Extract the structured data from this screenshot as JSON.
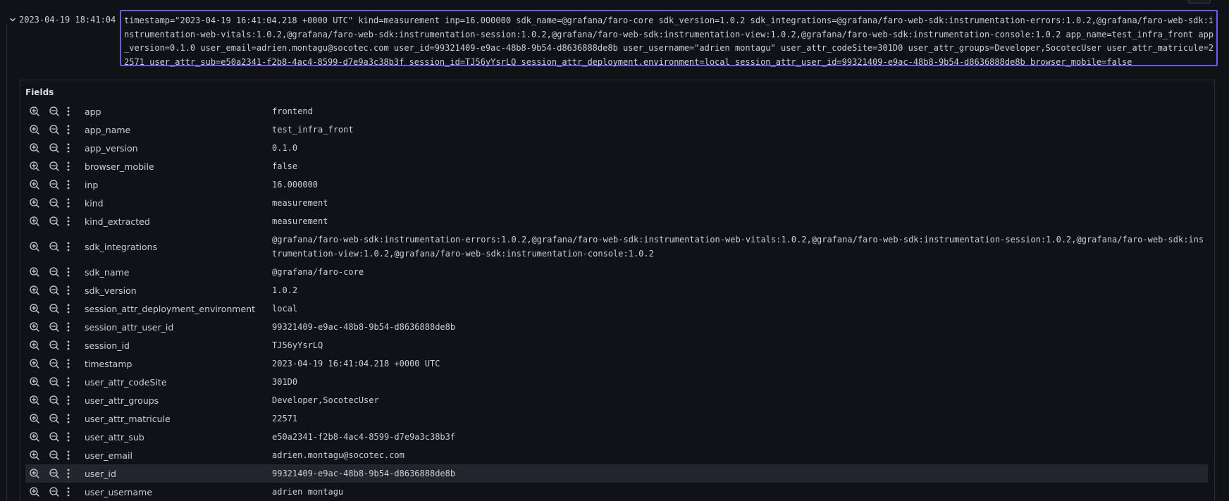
{
  "log": {
    "timestamp": "2023-04-19 18:41:04",
    "line": "timestamp=\"2023-04-19 16:41:04.218 +0000 UTC\" kind=measurement inp=16.000000 sdk_name=@grafana/faro-core sdk_version=1.0.2 sdk_integrations=@grafana/faro-web-sdk:instrumentation-errors:1.0.2,@grafana/faro-web-sdk:instrumentation-web-vitals:1.0.2,@grafana/faro-web-sdk:instrumentation-session:1.0.2,@grafana/faro-web-sdk:instrumentation-view:1.0.2,@grafana/faro-web-sdk:instrumentation-console:1.0.2 app_name=test_infra_front app_version=0.1.0 user_email=adrien.montagu@socotec.com user_id=99321409-e9ac-48b8-9b54-d8636888de8b user_username=\"adrien montagu\" user_attr_codeSite=301D0 user_attr_groups=Developer,SocotecUser user_attr_matricule=22571 user_attr_sub=e50a2341-f2b8-4ac4-8599-d7e9a3c38b3f session_id=TJ56yYsrLQ session_attr_deployment.environment=local session_attr_user_id=99321409-e9ac-48b8-9b54-d8636888de8b browser_mobile=false"
  },
  "details": {
    "title": "Fields",
    "fields": [
      {
        "key": "app",
        "value": "frontend"
      },
      {
        "key": "app_name",
        "value": "test_infra_front"
      },
      {
        "key": "app_version",
        "value": "0.1.0"
      },
      {
        "key": "browser_mobile",
        "value": "false"
      },
      {
        "key": "inp",
        "value": "16.000000"
      },
      {
        "key": "kind",
        "value": "measurement"
      },
      {
        "key": "kind_extracted",
        "value": "measurement"
      },
      {
        "key": "sdk_integrations",
        "value": "@grafana/faro-web-sdk:instrumentation-errors:1.0.2,@grafana/faro-web-sdk:instrumentation-web-vitals:1.0.2,@grafana/faro-web-sdk:instrumentation-session:1.0.2,@grafana/faro-web-sdk:instrumentation-view:1.0.2,@grafana/faro-web-sdk:instrumentation-console:1.0.2"
      },
      {
        "key": "sdk_name",
        "value": "@grafana/faro-core"
      },
      {
        "key": "sdk_version",
        "value": "1.0.2"
      },
      {
        "key": "session_attr_deployment_environment",
        "value": "local"
      },
      {
        "key": "session_attr_user_id",
        "value": "99321409-e9ac-48b8-9b54-d8636888de8b"
      },
      {
        "key": "session_id",
        "value": "TJ56yYsrLQ"
      },
      {
        "key": "timestamp",
        "value": "2023-04-19 16:41:04.218 +0000 UTC"
      },
      {
        "key": "user_attr_codeSite",
        "value": "301D0"
      },
      {
        "key": "user_attr_groups",
        "value": "Developer,SocotecUser"
      },
      {
        "key": "user_attr_matricule",
        "value": "22571"
      },
      {
        "key": "user_attr_sub",
        "value": "e50a2341-f2b8-4ac4-8599-d7e9a3c38b3f"
      },
      {
        "key": "user_email",
        "value": "adrien.montagu@socotec.com"
      },
      {
        "key": "user_id",
        "value": "99321409-e9ac-48b8-9b54-d8636888de8b"
      },
      {
        "key": "user_username",
        "value": "adrien montagu"
      }
    ]
  },
  "icons": {
    "expand": "chevron-down-icon",
    "filter_for": "zoom-in-icon",
    "filter_out": "zoom-out-icon",
    "more": "kebab-menu-icon"
  },
  "colors": {
    "background": "#111217",
    "text": "#ccccdc",
    "selected_border": "#6e5af2",
    "panel_border": "#2d2f36",
    "hover_row": "#22252b"
  }
}
